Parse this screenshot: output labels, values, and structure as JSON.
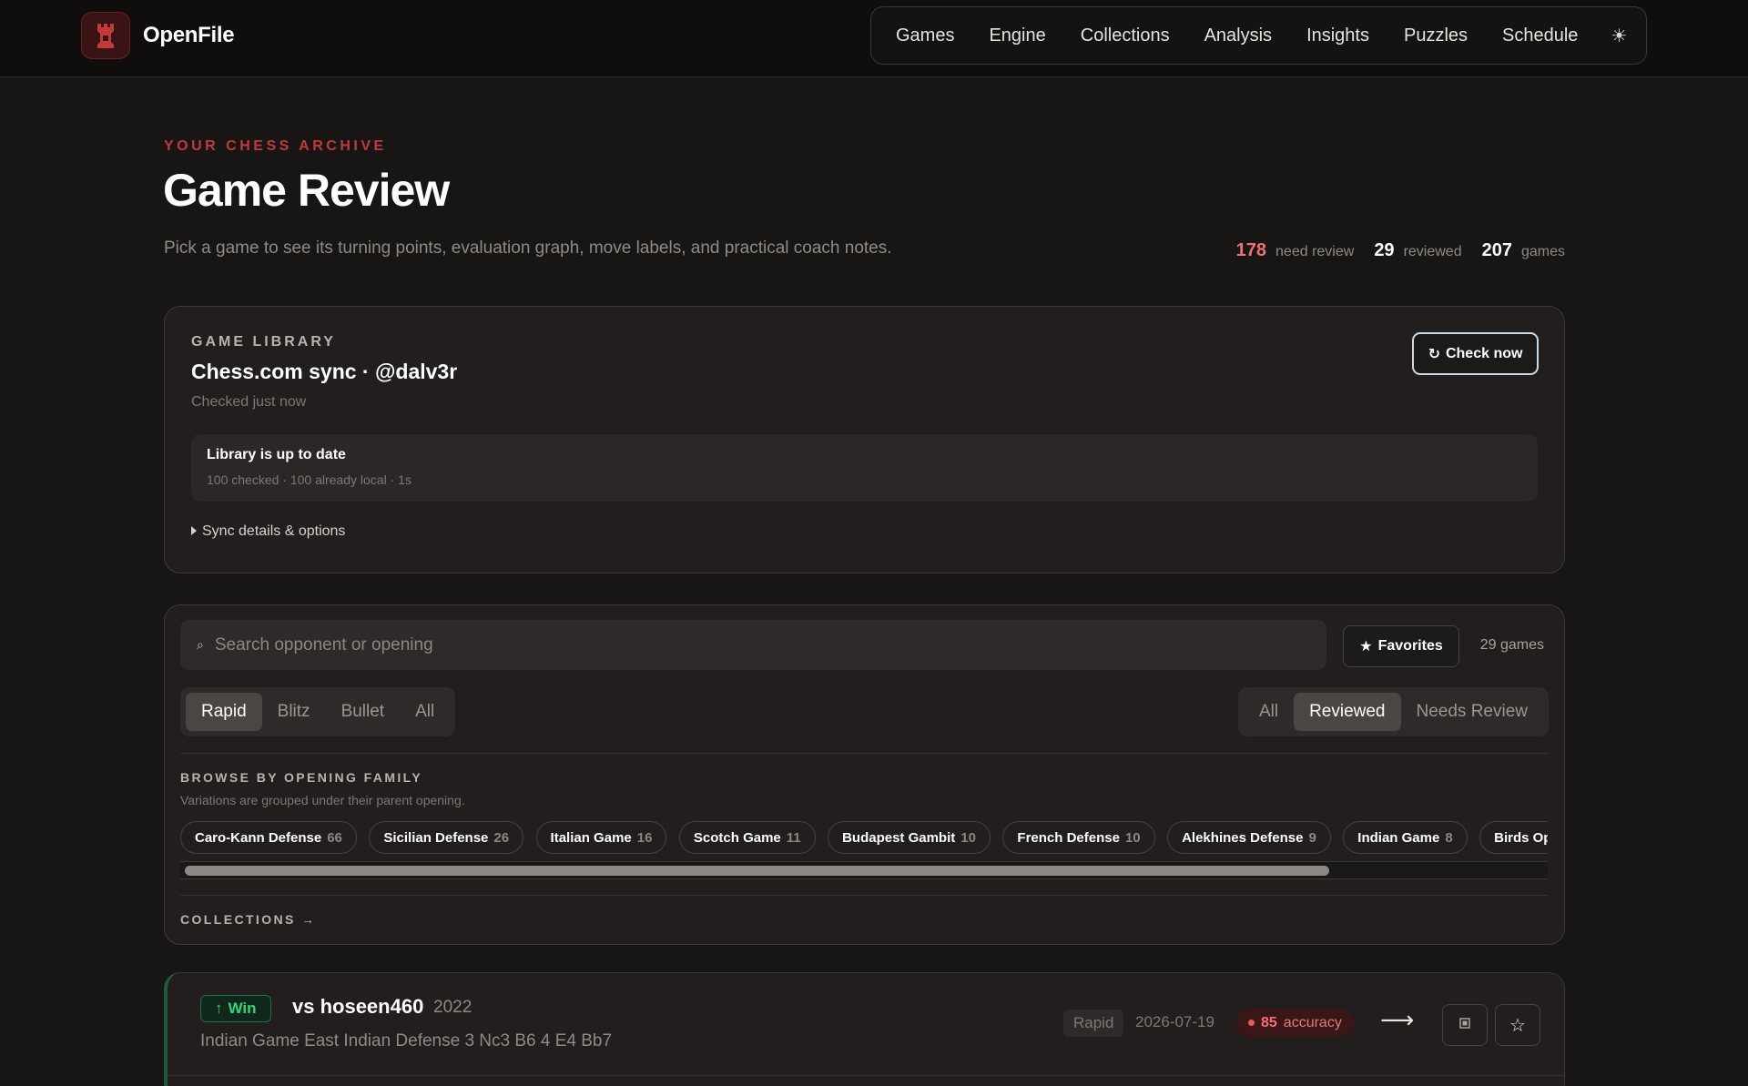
{
  "app": {
    "name": "OpenFile",
    "icons": {
      "logo": "rook-logo-icon",
      "theme": "sun-icon"
    },
    "colors": {
      "accent": "#c23a3a",
      "win": "#33d37f",
      "background": "#181615"
    }
  },
  "nav": {
    "items": [
      "Games",
      "Engine",
      "Collections",
      "Analysis",
      "Insights",
      "Puzzles",
      "Schedule"
    ]
  },
  "header": {
    "eyebrow": "YOUR CHESS ARCHIVE",
    "title": "Game Review",
    "subtitle": "Pick a game to see its turning points, evaluation graph, move labels, and practical coach notes.",
    "stats": [
      {
        "value": "178",
        "label": "need review"
      },
      {
        "value": "29",
        "label": "reviewed"
      },
      {
        "value": "207",
        "label": "games"
      }
    ]
  },
  "library": {
    "eyebrow": "GAME LIBRARY",
    "title": "Chess.com sync · @dalv3r",
    "checked": "Checked just now",
    "check_button": "Check now",
    "status_title": "Library is up to date",
    "status_detail": "100 checked · 100 already local · 1s",
    "sync_toggle": "Sync details & options"
  },
  "filters": {
    "search_placeholder": "Search opponent or opening",
    "favorites_label": "Favorites",
    "game_count": "29 games",
    "time_controls": [
      "Rapid",
      "Blitz",
      "Bullet",
      "All"
    ],
    "time_control_selected": "Rapid",
    "review_status": [
      "All",
      "Reviewed",
      "Needs Review"
    ],
    "review_status_selected": "Reviewed",
    "family_eyebrow": "BROWSE BY OPENING FAMILY",
    "family_note": "Variations are grouped under their parent opening.",
    "families": [
      {
        "name": "Caro-Kann Defense",
        "count": "66"
      },
      {
        "name": "Sicilian Defense",
        "count": "26"
      },
      {
        "name": "Italian Game",
        "count": "16"
      },
      {
        "name": "Scotch Game",
        "count": "11"
      },
      {
        "name": "Budapest Gambit",
        "count": "10"
      },
      {
        "name": "French Defense",
        "count": "10"
      },
      {
        "name": "Alekhines Defense",
        "count": "9"
      },
      {
        "name": "Indian Game",
        "count": "8"
      },
      {
        "name": "Birds Opening",
        "count": ""
      }
    ],
    "collections_link": "COLLECTIONS →"
  },
  "games": [
    {
      "result": "Win",
      "opponent": "vs hoseen460",
      "rating": "2022",
      "opening": "Indian Game East Indian Defense 3 Nc3 B6 4 E4 Bb7",
      "time_control": "Rapid",
      "date": "2026-07-19",
      "accuracy": "85",
      "accuracy_label": "accuracy"
    }
  ]
}
